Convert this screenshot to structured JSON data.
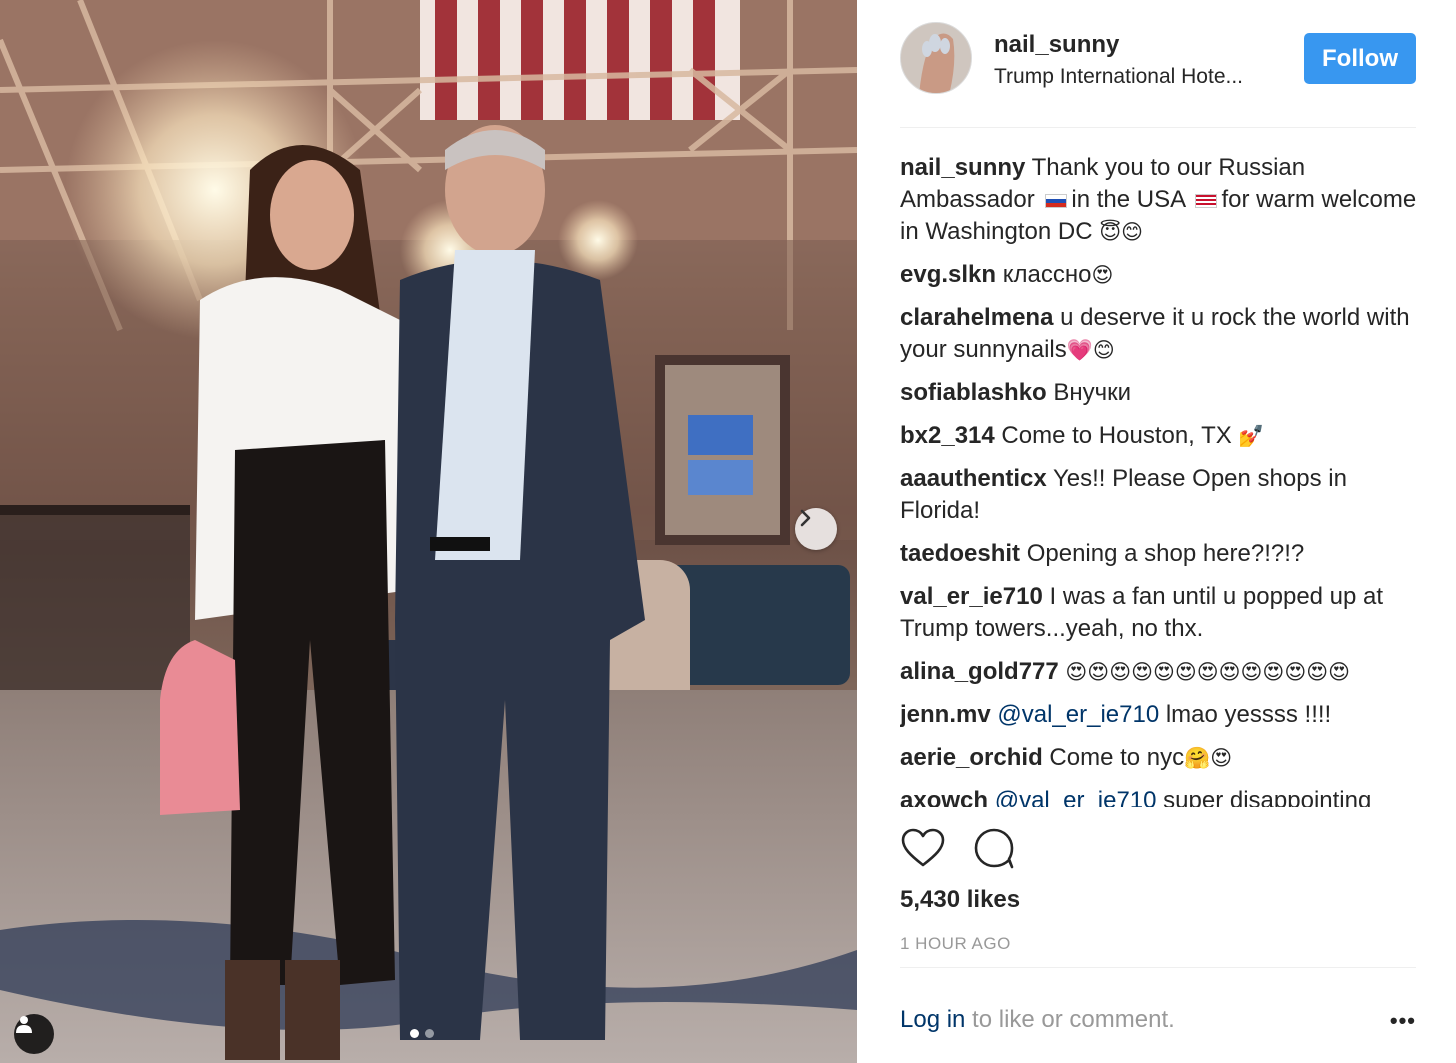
{
  "post": {
    "username": "nail_sunny",
    "location": "Trump International Hote...",
    "follow_label": "Follow",
    "likes": "5,430 likes",
    "time": "1 HOUR AGO",
    "login_link": "Log in",
    "login_rest": " to like or comment.",
    "more": "•••"
  },
  "caption": {
    "user": "nail_sunny",
    "text_1": " Thank you to our Russian Ambassador",
    "text_2": "in the USA",
    "text_3": "for warm welcome in Washington DC ",
    "emoji": "😇😊"
  },
  "comments": [
    {
      "user": "evg.slkn",
      "text": " классно",
      "emoji": "😍"
    },
    {
      "user": "clarahelmena",
      "text": " u deserve it u rock the world with your sunnynails",
      "emoji": "💗😊"
    },
    {
      "user": "sofiablashko",
      "text": " Внучки",
      "emoji": ""
    },
    {
      "user": "bx2_314",
      "text": " Come to Houston, TX ",
      "emoji": "💅"
    },
    {
      "user": "aaauthenticx",
      "text": " Yes!! Please Open shops in Florida!",
      "emoji": ""
    },
    {
      "user": "taedoeshit",
      "text": " Opening a shop here?!?!?",
      "emoji": ""
    },
    {
      "user": "val_er_ie710",
      "text": " I was a fan until u popped up at Trump towers...yeah, no thx.",
      "emoji": ""
    },
    {
      "user": "alina_gold777",
      "text": " ",
      "emoji": "😍😍😍😍😍😍😍😍😍😍😍😍😍"
    },
    {
      "user": "jenn.mv",
      "mention": " @val_er_ie710",
      "text": " lmao yessss !!!!",
      "emoji": ""
    },
    {
      "user": "aerie_orchid",
      "text": " Come to nyc",
      "emoji": "🤗😍"
    },
    {
      "user": "axowch",
      "mention": " @val_er_ie710",
      "text": " super disappointing",
      "emoji": ""
    }
  ],
  "icons": {
    "like": "heart-outline",
    "comment": "speech-bubble-outline",
    "next": "chevron-right",
    "user_tag": "person"
  },
  "colors": {
    "follow_button": "#3897f0",
    "link": "#003569",
    "muted": "#999999"
  },
  "carousel": {
    "slides": 2,
    "active": 1
  }
}
